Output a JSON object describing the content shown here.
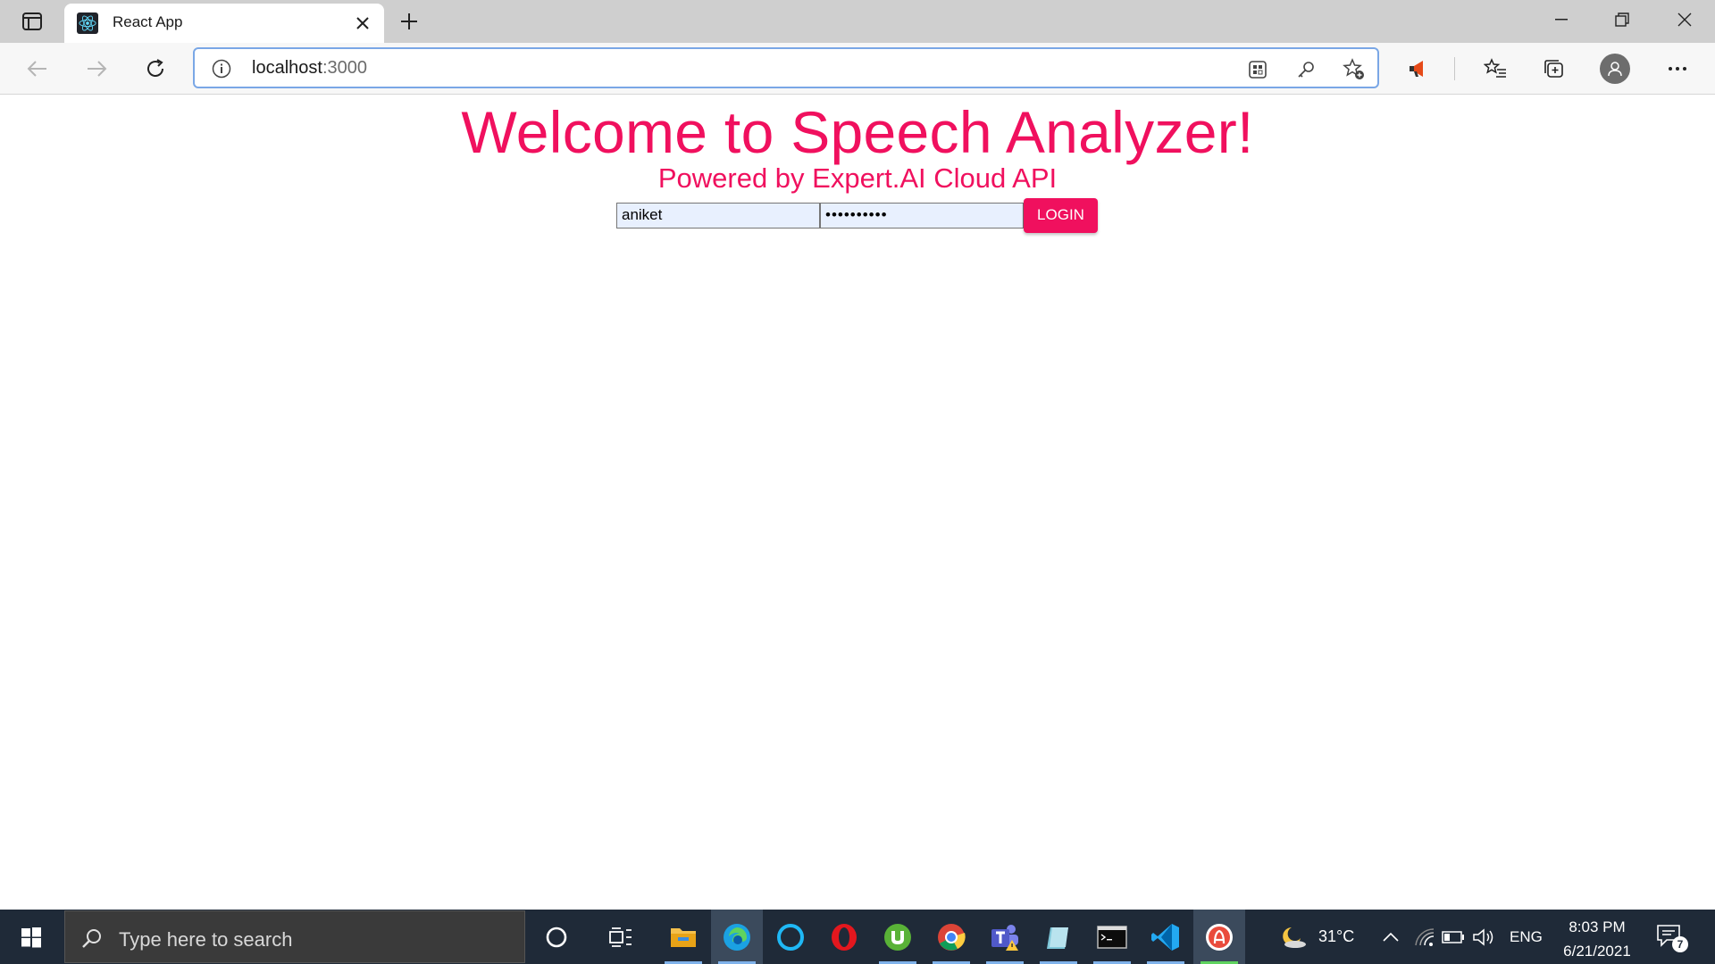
{
  "browser": {
    "tab_title": "React App",
    "url_host": "localhost",
    "url_port": ":3000"
  },
  "page": {
    "heading": "Welcome to Speech Analyzer!",
    "subheading": "Powered by Expert.AI Cloud API",
    "username_value": "aniket",
    "password_value": "••••••••••",
    "login_label": "LOGIN",
    "accent_color": "#f0105e"
  },
  "taskbar": {
    "search_placeholder": "Type here to search",
    "weather_temp": "31°C",
    "language": "ENG",
    "time": "8:03 PM",
    "date": "6/21/2021",
    "notification_count": "7"
  }
}
